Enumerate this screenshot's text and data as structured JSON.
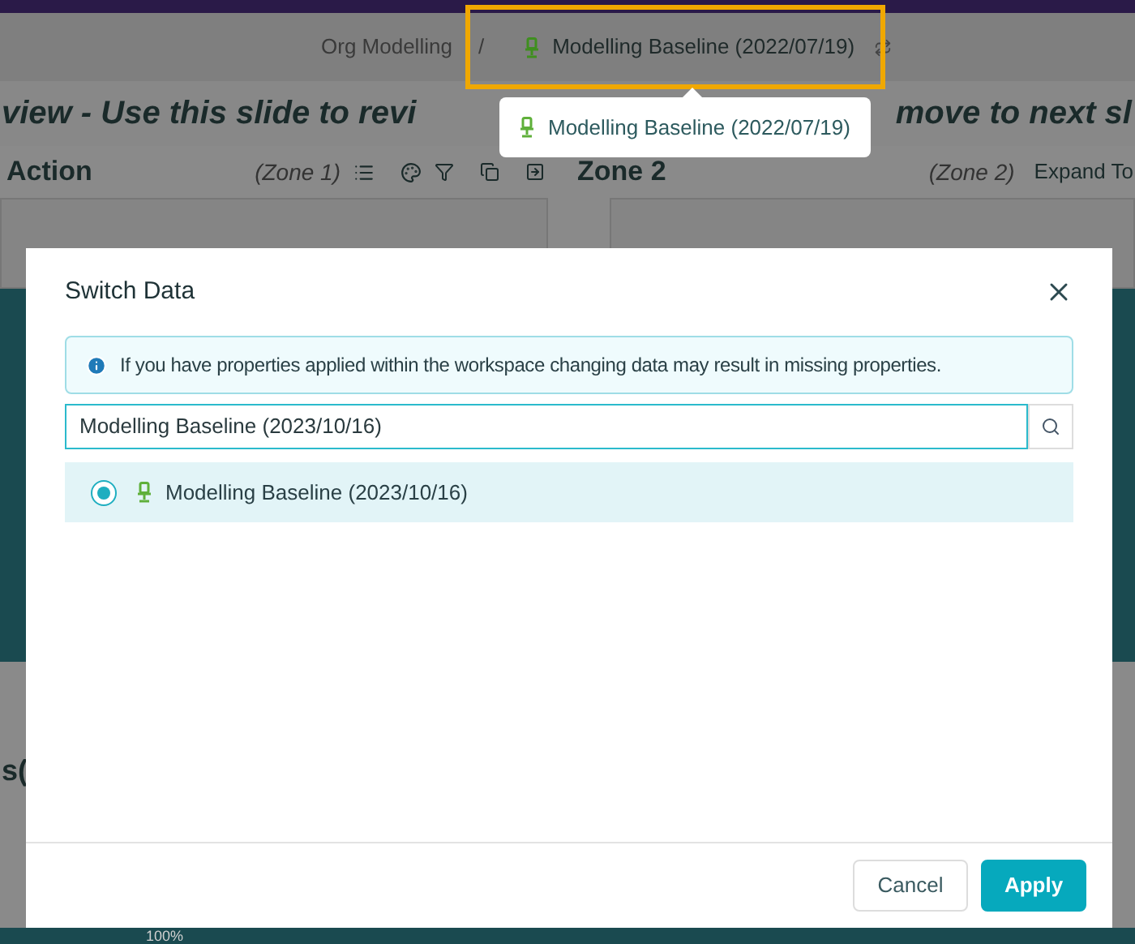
{
  "breadcrumb": {
    "parent": "Org Modelling",
    "separator": "/",
    "current": "Modelling Baseline (2022/07/19)"
  },
  "dropdown": {
    "items": [
      "Modelling Baseline (2022/07/19)"
    ]
  },
  "slide_title": [
    "view - Use this slide to revi",
    "move to next sl"
  ],
  "zones": [
    {
      "title": "Action",
      "label": "(Zone 1)"
    },
    {
      "title": "Zone 2",
      "label": "(Zone 2)",
      "action": "Expand To"
    }
  ],
  "background_texts": [
    "s(",
    "100%"
  ],
  "dialog": {
    "title": "Switch Data",
    "info": "If you have properties applied within the workspace changing data may result in missing properties.",
    "search": {
      "value": "Modelling Baseline (2023/10/16)"
    },
    "options": [
      {
        "label": "Modelling Baseline (2023/10/16)",
        "selected": true
      }
    ],
    "buttons": [
      {
        "label": "Cancel",
        "kind": "secondary"
      },
      {
        "label": "Apply",
        "kind": "primary"
      }
    ]
  }
}
